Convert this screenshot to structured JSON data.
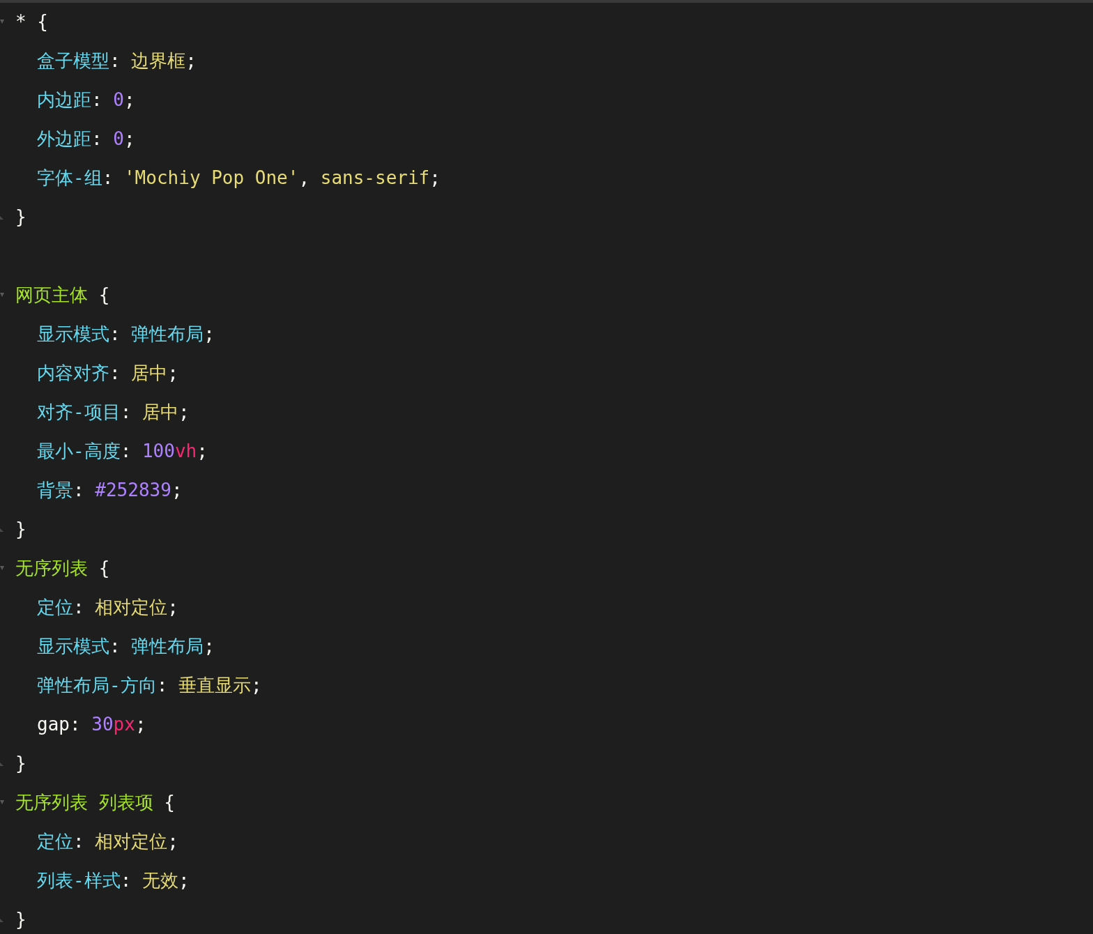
{
  "rule_groups": [
    [
      {
        "selector": [
          {
            "kind": "punct",
            "text": "* {"
          }
        ],
        "declarations": [
          [
            {
              "kind": "property",
              "text": "盒子模型"
            },
            {
              "kind": "punct",
              "text": ": "
            },
            {
              "kind": "value",
              "text": "边界框"
            },
            {
              "kind": "punct",
              "text": ";"
            }
          ],
          [
            {
              "kind": "property",
              "text": "内边距"
            },
            {
              "kind": "punct",
              "text": ": "
            },
            {
              "kind": "number",
              "text": "0"
            },
            {
              "kind": "punct",
              "text": ";"
            }
          ],
          [
            {
              "kind": "property",
              "text": "外边距"
            },
            {
              "kind": "punct",
              "text": ": "
            },
            {
              "kind": "number",
              "text": "0"
            },
            {
              "kind": "punct",
              "text": ";"
            }
          ],
          [
            {
              "kind": "property",
              "text": "字体-组"
            },
            {
              "kind": "punct",
              "text": ": "
            },
            {
              "kind": "value",
              "text": "'Mochiy Pop One'"
            },
            {
              "kind": "punct",
              "text": ", "
            },
            {
              "kind": "value",
              "text": "sans-serif"
            },
            {
              "kind": "punct",
              "text": ";"
            }
          ]
        ],
        "closing": "}"
      }
    ],
    [
      {
        "selector": [
          {
            "kind": "selector",
            "text": "网页主体"
          },
          {
            "kind": "punct",
            "text": " {"
          }
        ],
        "declarations": [
          [
            {
              "kind": "property",
              "text": "显示模式"
            },
            {
              "kind": "punct",
              "text": ": "
            },
            {
              "kind": "property",
              "text": "弹性布局"
            },
            {
              "kind": "punct",
              "text": ";"
            }
          ],
          [
            {
              "kind": "property",
              "text": "内容对齐"
            },
            {
              "kind": "punct",
              "text": ": "
            },
            {
              "kind": "value",
              "text": "居中"
            },
            {
              "kind": "punct",
              "text": ";"
            }
          ],
          [
            {
              "kind": "property",
              "text": "对齐-项目"
            },
            {
              "kind": "punct",
              "text": ": "
            },
            {
              "kind": "value",
              "text": "居中"
            },
            {
              "kind": "punct",
              "text": ";"
            }
          ],
          [
            {
              "kind": "property",
              "text": "最小-高度"
            },
            {
              "kind": "punct",
              "text": ": "
            },
            {
              "kind": "number",
              "text": "100"
            },
            {
              "kind": "unit",
              "text": "vh"
            },
            {
              "kind": "punct",
              "text": ";"
            }
          ],
          [
            {
              "kind": "property",
              "text": "背景"
            },
            {
              "kind": "punct",
              "text": ": "
            },
            {
              "kind": "number",
              "text": "#252839"
            },
            {
              "kind": "punct",
              "text": ";"
            }
          ]
        ],
        "closing": "}"
      },
      {
        "selector": [
          {
            "kind": "selector",
            "text": "无序列表"
          },
          {
            "kind": "punct",
            "text": " {"
          }
        ],
        "declarations": [
          [
            {
              "kind": "property",
              "text": "定位"
            },
            {
              "kind": "punct",
              "text": ": "
            },
            {
              "kind": "value",
              "text": "相对定位"
            },
            {
              "kind": "punct",
              "text": ";"
            }
          ],
          [
            {
              "kind": "property",
              "text": "显示模式"
            },
            {
              "kind": "punct",
              "text": ": "
            },
            {
              "kind": "property",
              "text": "弹性布局"
            },
            {
              "kind": "punct",
              "text": ";"
            }
          ],
          [
            {
              "kind": "property",
              "text": "弹性布局-方向"
            },
            {
              "kind": "punct",
              "text": ": "
            },
            {
              "kind": "value",
              "text": "垂直显示"
            },
            {
              "kind": "punct",
              "text": ";"
            }
          ],
          [
            {
              "kind": "punct",
              "text": "gap: "
            },
            {
              "kind": "number",
              "text": "30"
            },
            {
              "kind": "unit",
              "text": "px"
            },
            {
              "kind": "punct",
              "text": ";"
            }
          ]
        ],
        "closing": "}"
      },
      {
        "selector": [
          {
            "kind": "selector",
            "text": "无序列表 列表项"
          },
          {
            "kind": "punct",
            "text": " {"
          }
        ],
        "declarations": [
          [
            {
              "kind": "property",
              "text": "定位"
            },
            {
              "kind": "punct",
              "text": ": "
            },
            {
              "kind": "value",
              "text": "相对定位"
            },
            {
              "kind": "punct",
              "text": ";"
            }
          ],
          [
            {
              "kind": "property",
              "text": "列表-样式"
            },
            {
              "kind": "punct",
              "text": ": "
            },
            {
              "kind": "value",
              "text": "无效"
            },
            {
              "kind": "punct",
              "text": ";"
            }
          ]
        ],
        "closing": "}"
      }
    ]
  ]
}
